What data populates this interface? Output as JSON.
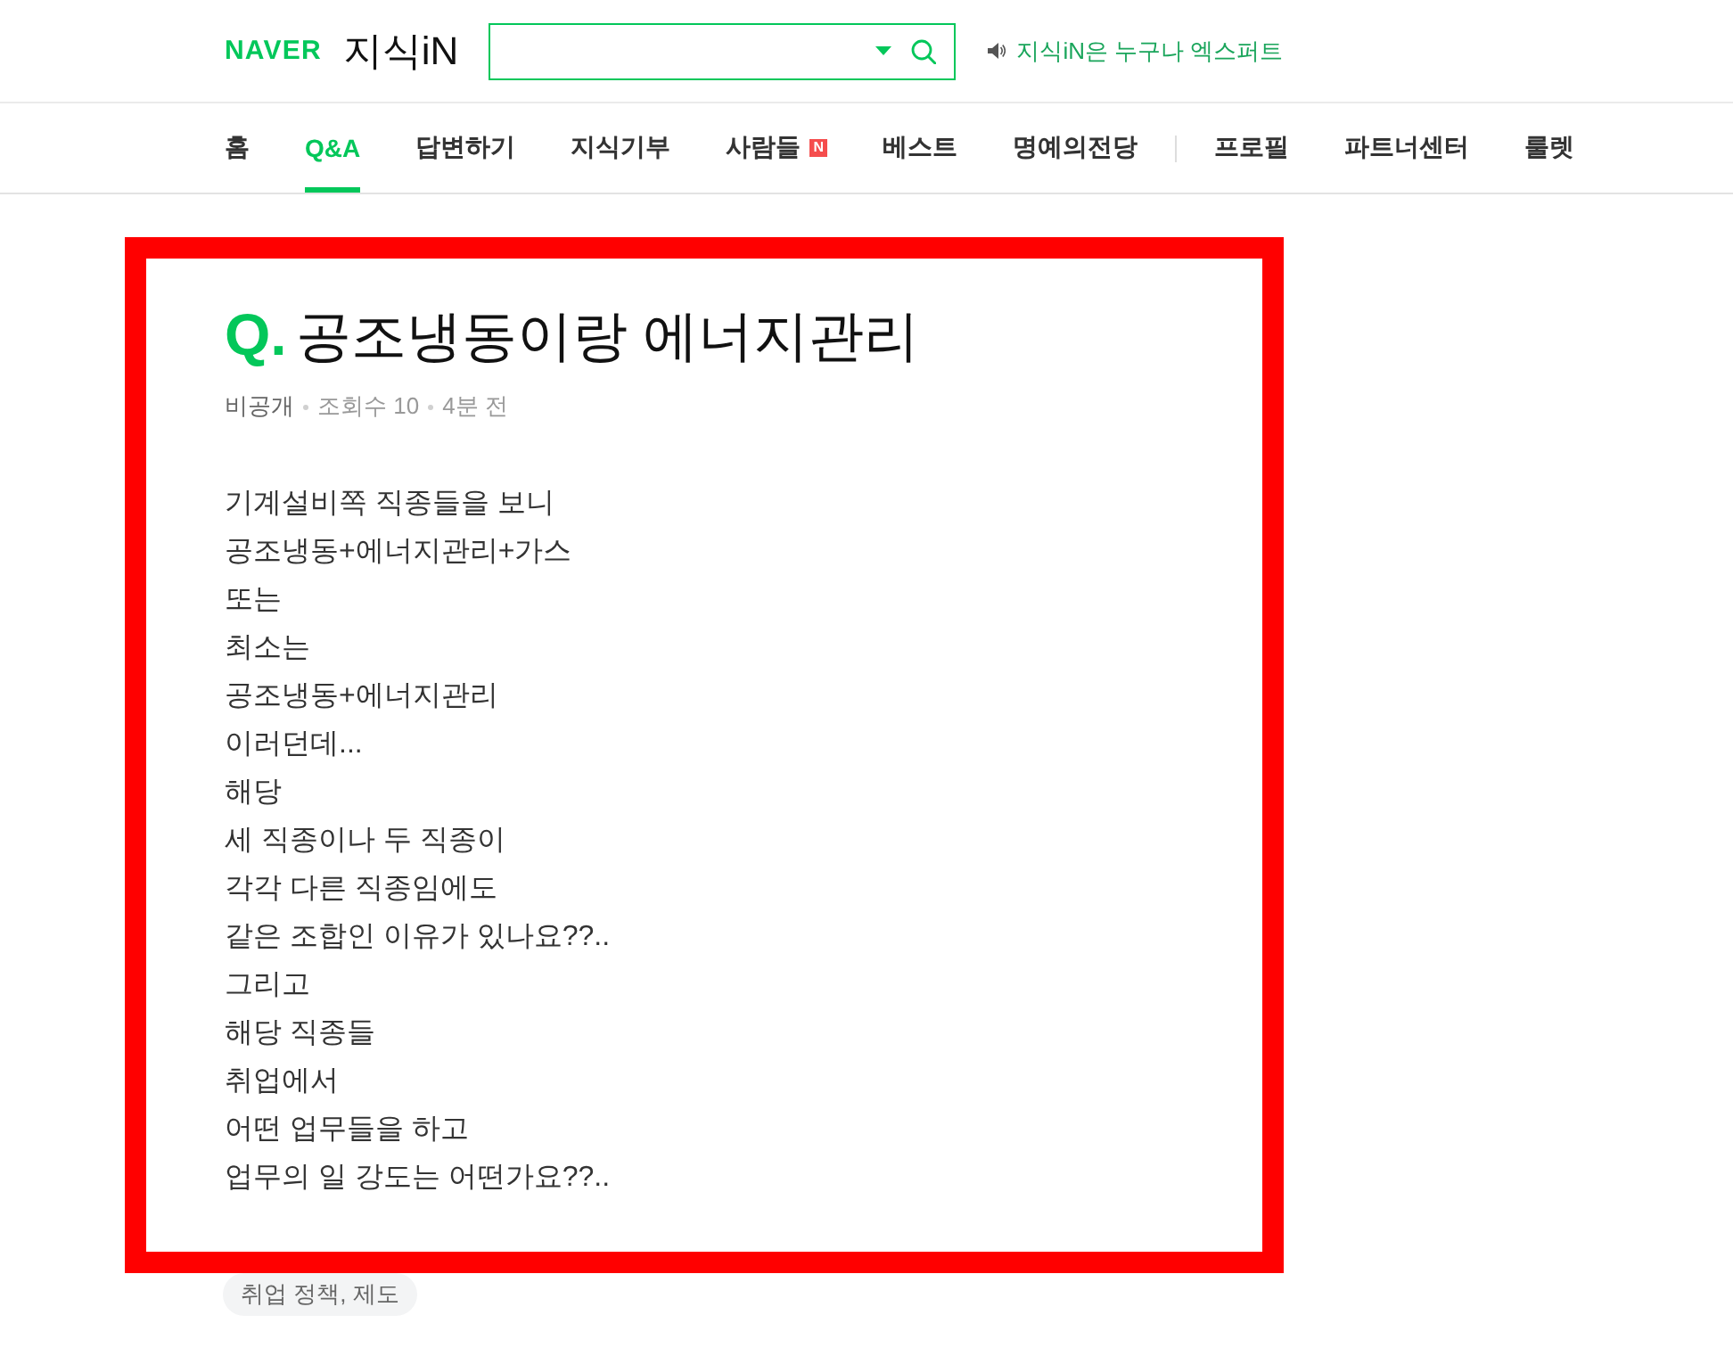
{
  "header": {
    "logo": {
      "brand": "NAVER",
      "service": "지식iN"
    },
    "notice": "지식iN은 누구나 엑스퍼트"
  },
  "nav": {
    "groups": [
      [
        {
          "label": "홈",
          "selected": false
        },
        {
          "label": "Q&A",
          "selected": true
        },
        {
          "label": "답변하기",
          "selected": false
        },
        {
          "label": "지식기부",
          "selected": false
        },
        {
          "label": "사람들",
          "selected": false,
          "badge": "N"
        },
        {
          "label": "베스트",
          "selected": false
        },
        {
          "label": "명예의전당",
          "selected": false
        }
      ],
      [
        {
          "label": "프로필",
          "selected": false
        },
        {
          "label": "파트너센터",
          "selected": false
        },
        {
          "label": "룰렛",
          "selected": false
        }
      ]
    ]
  },
  "question": {
    "prefix": "Q.",
    "title": "공조냉동이랑 에너지관리",
    "meta": [
      "비공개",
      "조회수 10",
      "4분 전"
    ],
    "body": [
      "기계설비쪽 직종들을 보니",
      "공조냉동+에너지관리+가스",
      "또는",
      "최소는",
      "공조냉동+에너지관리",
      "이러던데...",
      "해당",
      "세 직종이나 두 직종이",
      "각각 다른 직종임에도",
      "같은 조합인 이유가 있나요??..",
      "그리고",
      "해당 직종들",
      "취업에서",
      "어떤 업무들을 하고",
      "업무의 일 강도는 어떤가요??.."
    ],
    "tags": [
      "취업 정책, 제도"
    ]
  }
}
